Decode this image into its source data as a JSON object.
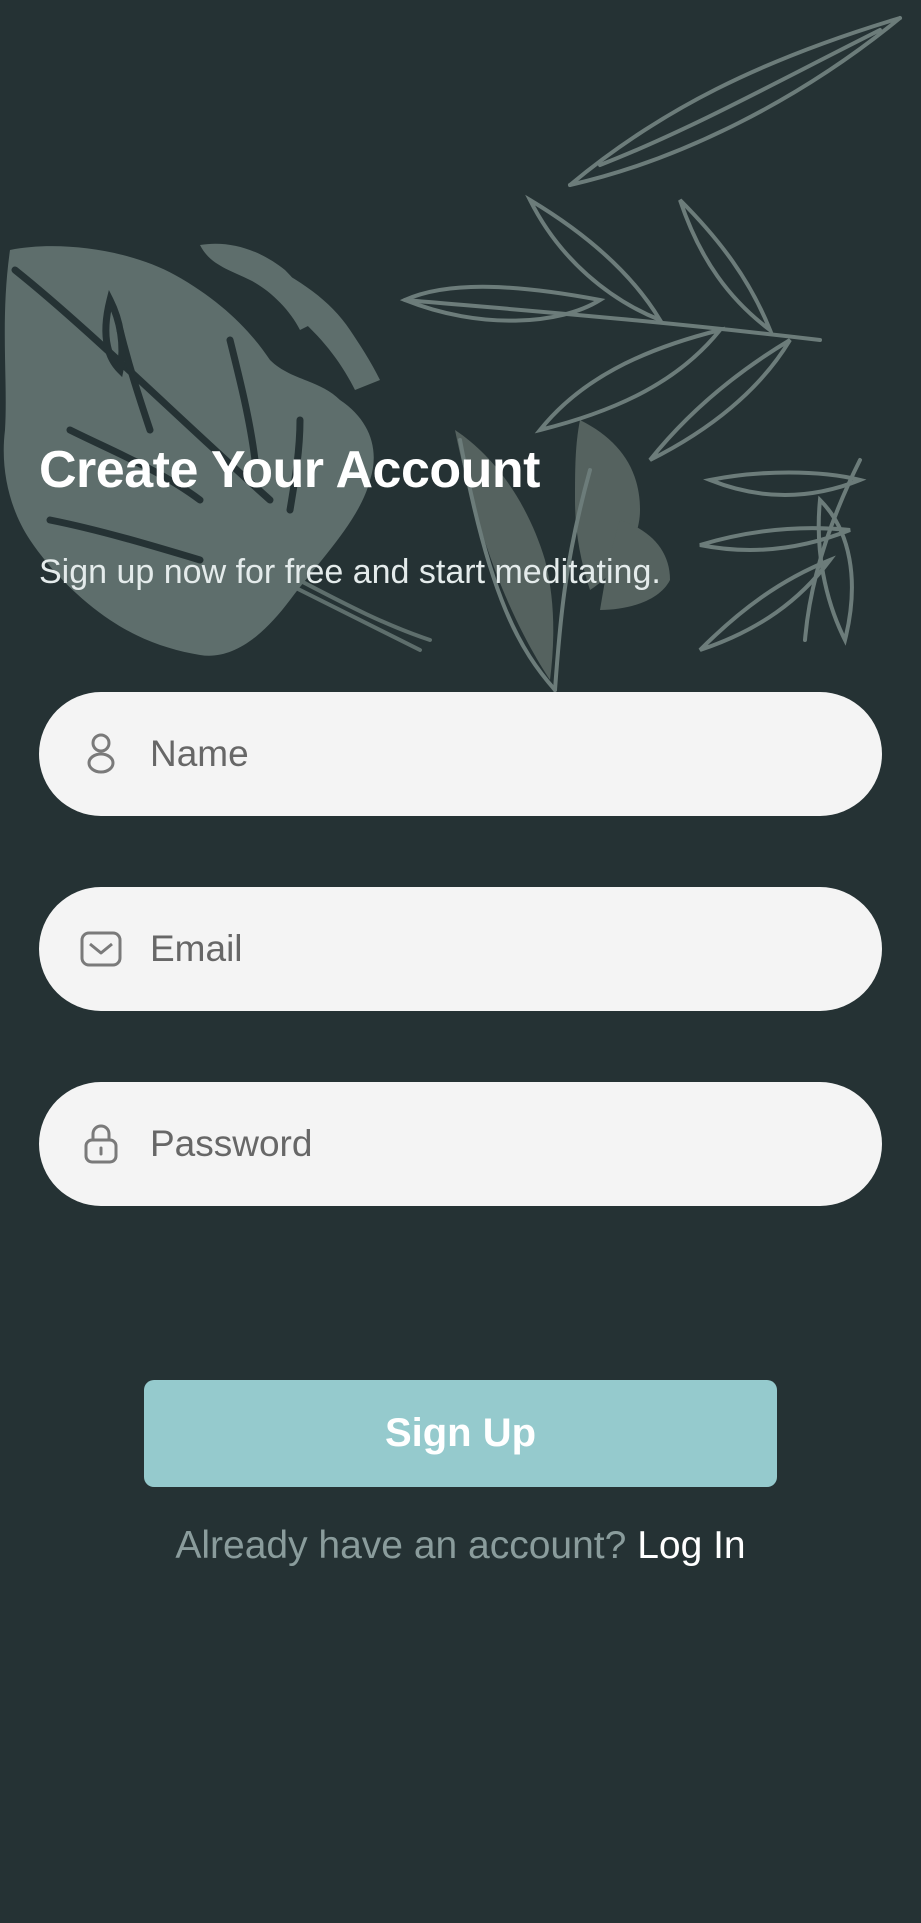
{
  "header": {
    "title": "Create Your Account",
    "subtitle": "Sign up now for free and start meditating."
  },
  "form": {
    "name": {
      "placeholder": "Name",
      "icon": "person-icon"
    },
    "email": {
      "placeholder": "Email",
      "icon": "envelope-icon"
    },
    "password": {
      "placeholder": "Password",
      "icon": "lock-icon"
    }
  },
  "actions": {
    "signup_label": "Sign Up",
    "login_prompt": "Already have an account?",
    "login_link": "Log In"
  },
  "colors": {
    "background": "#253234",
    "field_background": "#F4F4F4",
    "button": "#95CACD",
    "foliage": "#5E6E6C",
    "muted_text": "#8A9C9C"
  }
}
